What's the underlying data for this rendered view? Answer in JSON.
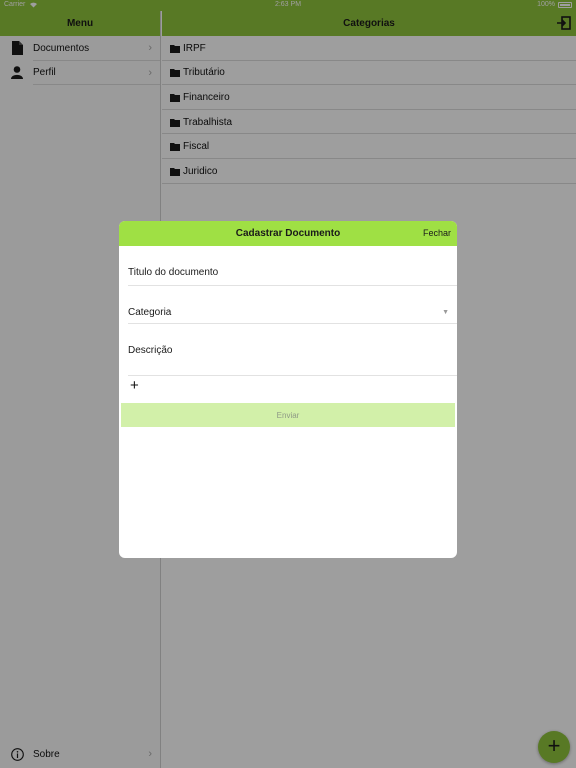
{
  "status_bar": {
    "carrier": "Carrier",
    "time": "2:63 PM",
    "battery": "100%"
  },
  "sidebar": {
    "title": "Menu",
    "items": [
      {
        "label": "Documentos",
        "icon": "document-icon"
      },
      {
        "label": "Perfil",
        "icon": "person-icon"
      }
    ],
    "footer_item": {
      "label": "Sobre",
      "icon": "info-icon"
    }
  },
  "main": {
    "title": "Categorias",
    "categories": [
      "IRPF",
      "Tributário",
      "Financeiro",
      "Trabalhista",
      "Fiscal",
      "Juridico"
    ]
  },
  "modal": {
    "title": "Cadastrar Documento",
    "close_label": "Fechar",
    "title_field": "Titulo do documento",
    "category_field": "Categoria",
    "description_field": "Descrição",
    "add_label": "+",
    "submit_label": "Enviar"
  },
  "fab": {
    "label": "+"
  },
  "colors": {
    "nav_green": "#8fc33c",
    "modal_header_green": "#9fe044",
    "submit_disabled": "#d2f0a9"
  }
}
